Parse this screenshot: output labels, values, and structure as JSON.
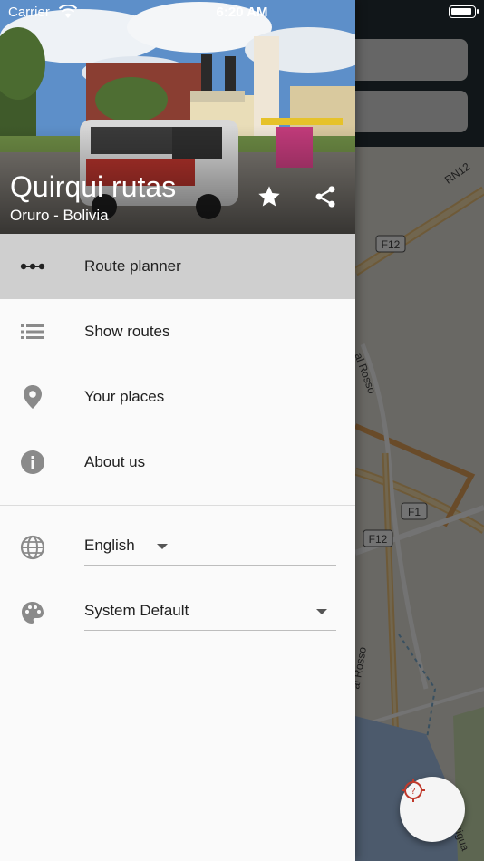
{
  "status_bar": {
    "carrier": "Carrier",
    "time": "6:20 AM"
  },
  "map": {
    "road_labels": [
      "F12",
      "F1",
      "F12",
      "RN12",
      "al Rosso",
      "al Rosso",
      "Antigua"
    ],
    "locate_button_icon": "location-target-icon"
  },
  "drawer": {
    "header": {
      "title": "Quirqui rutas",
      "subtitle": "Oruro - Bolivia",
      "favorite_icon": "star-icon",
      "share_icon": "share-icon"
    },
    "menu": [
      {
        "label": "Route planner",
        "icon": "route-icon",
        "active": true
      },
      {
        "label": "Show routes",
        "icon": "list-icon",
        "active": false
      },
      {
        "label": "Your places",
        "icon": "place-pin-icon",
        "active": false
      },
      {
        "label": "About us",
        "icon": "info-icon",
        "active": false
      }
    ],
    "settings": {
      "language": {
        "icon": "globe-icon",
        "value": "English"
      },
      "theme": {
        "icon": "palette-icon",
        "value": "System Default"
      }
    }
  },
  "colors": {
    "map_topbar": "#263238",
    "active_item_bg": "#cfcfcf",
    "drawer_bg": "#fafafa",
    "icon_grey": "#8a8a8a",
    "locate_red": "#e53935"
  }
}
